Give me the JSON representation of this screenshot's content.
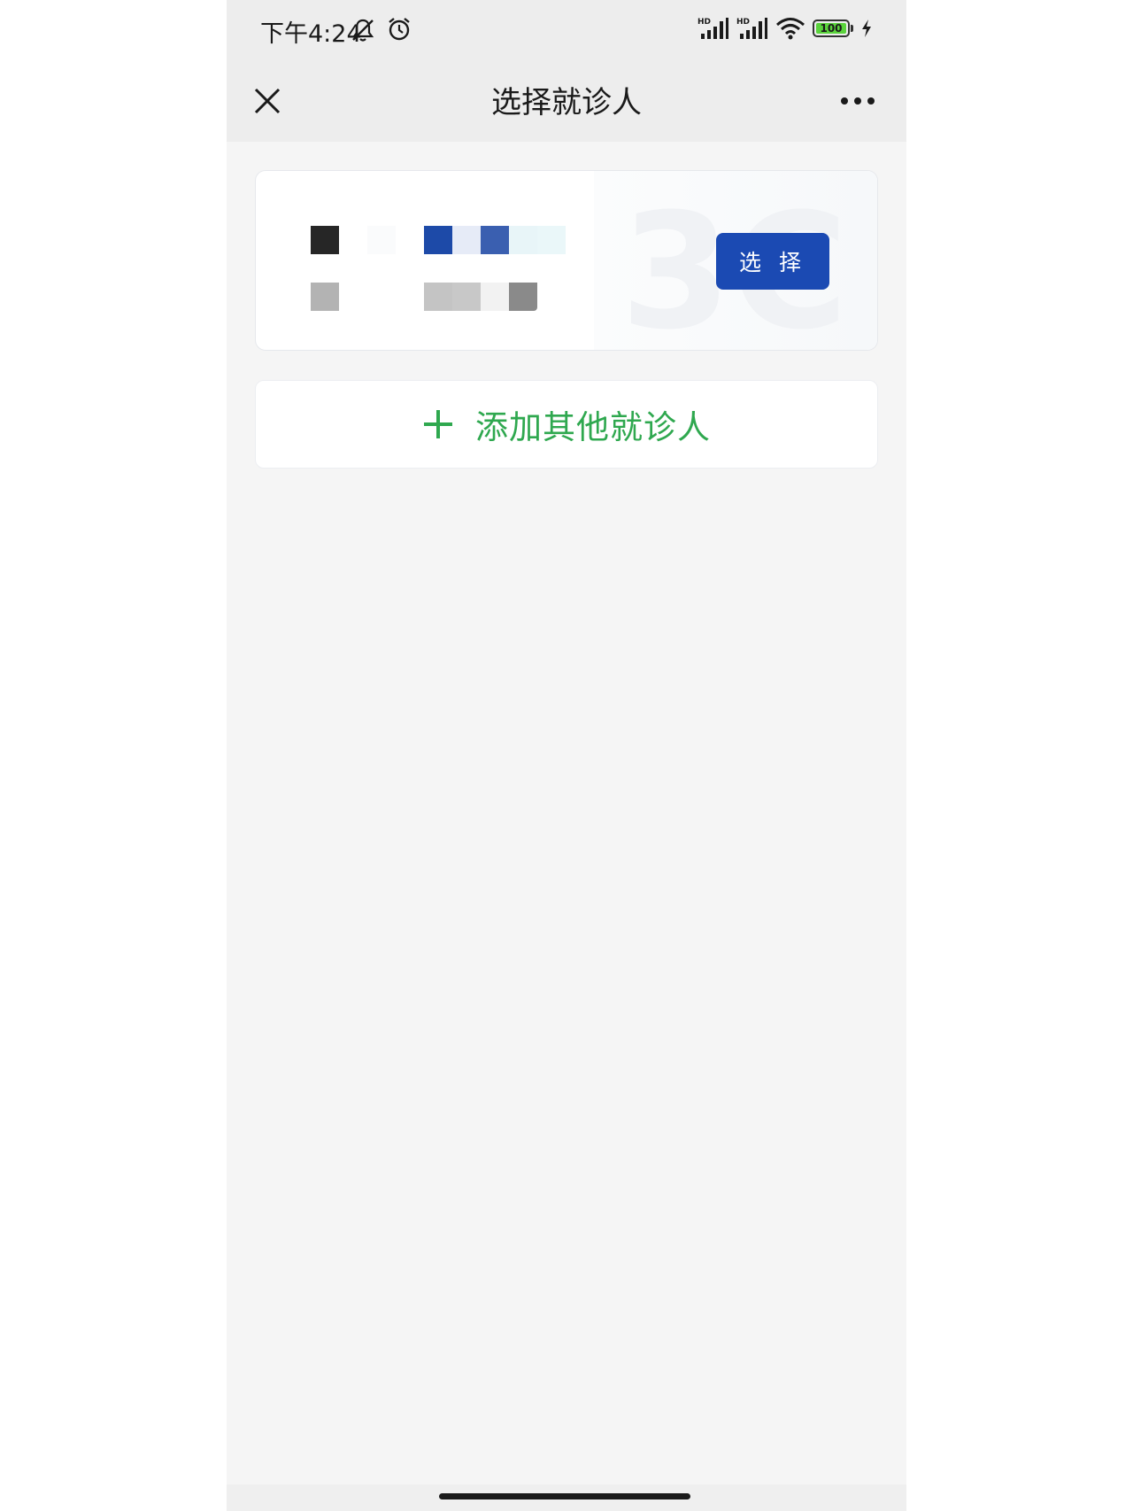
{
  "status_bar": {
    "time": "下午4:24",
    "battery_level": "100",
    "icons": [
      "mute-bell-icon",
      "alarm-icon",
      "hd-signal-icon",
      "hd-signal-icon",
      "wifi-icon",
      "battery-icon",
      "charging-icon"
    ]
  },
  "nav": {
    "title": "选择就诊人",
    "close_icon": "close-icon",
    "more_icon": "more-icon"
  },
  "patient_card": {
    "select_label": "选 择",
    "watermark_text": "3C"
  },
  "add_patient": {
    "icon": "plus-icon",
    "label": "添加其他就诊人"
  },
  "colors": {
    "primary_blue": "#1b4ab3",
    "add_green": "#2fa84f",
    "page_bg": "#f5f5f5",
    "header_bg": "#ededed"
  }
}
